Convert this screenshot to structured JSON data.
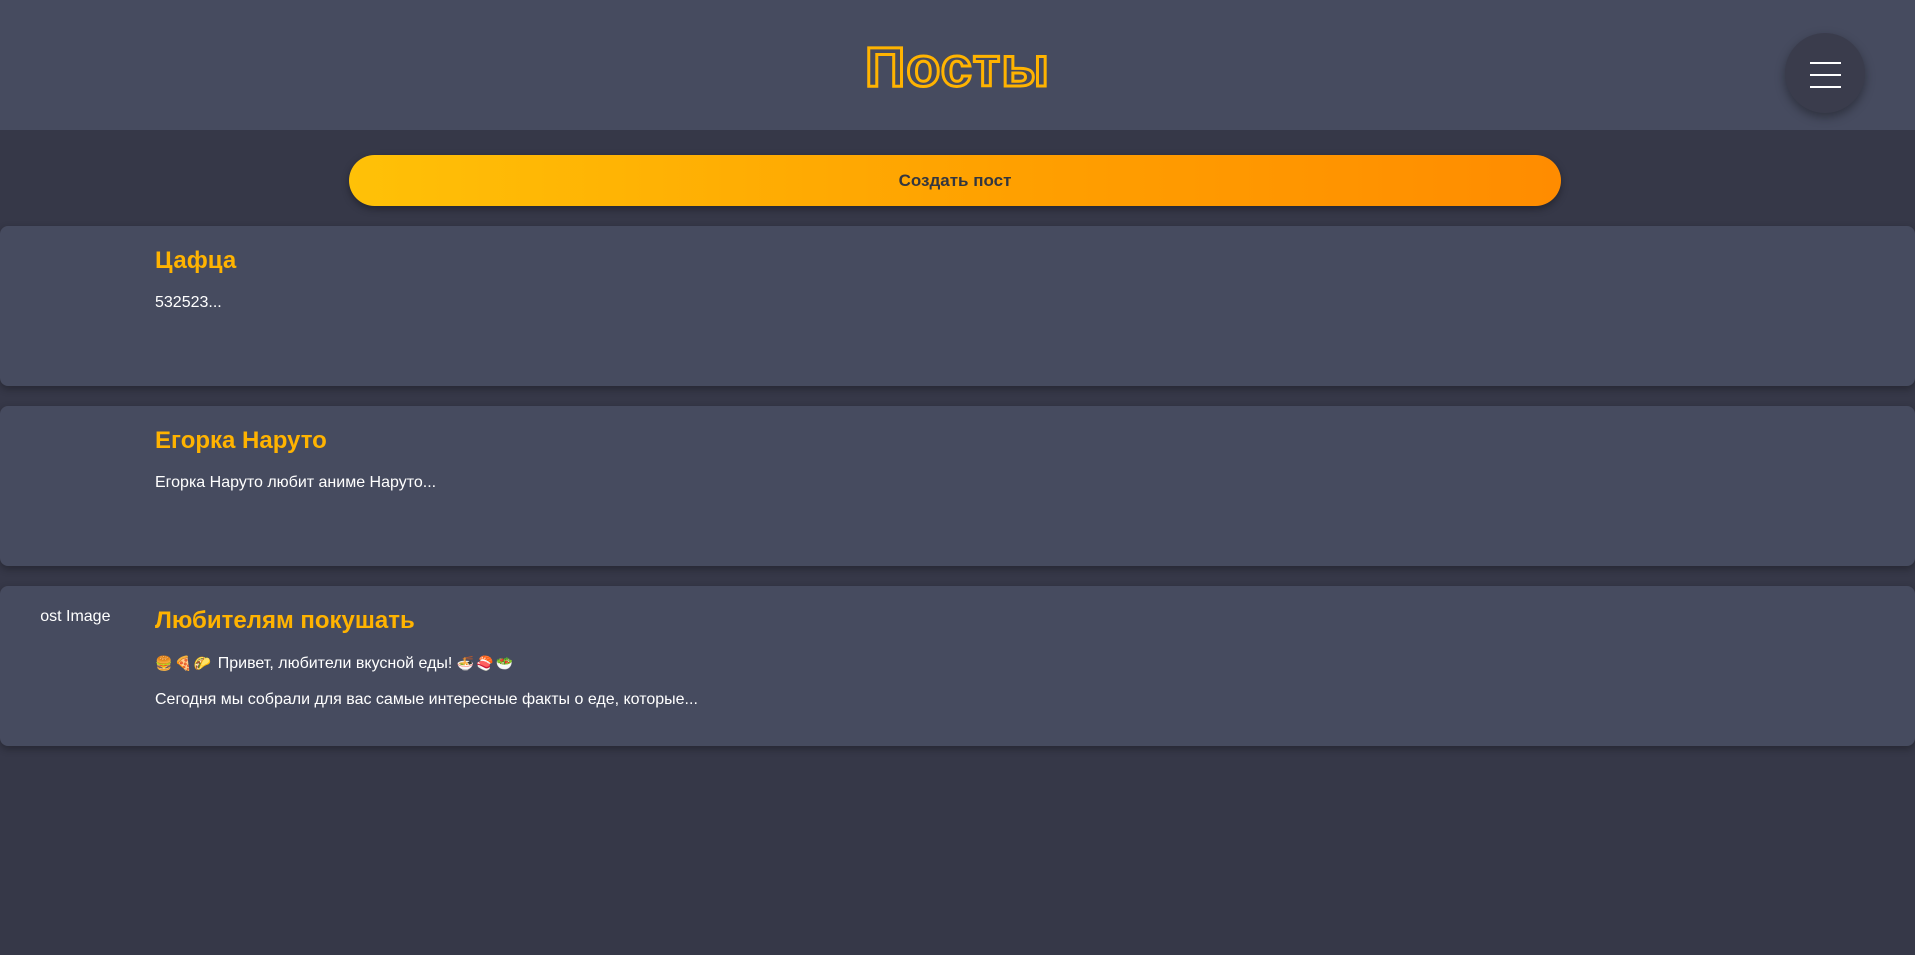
{
  "header": {
    "title": "Посты",
    "menu_icon": "hamburger-menu-icon"
  },
  "actions": {
    "create_post_label": "Создать пост"
  },
  "colors": {
    "accent": "#ffb300",
    "header_bg": "#464b5f",
    "page_bg": "#363848",
    "card_bg": "#464b5f",
    "button_gradient_start": "#ffc107",
    "button_gradient_end": "#ff8c00",
    "text": "#ffffff"
  },
  "posts": [
    {
      "title": "Цафца",
      "lines": [
        "532523..."
      ]
    },
    {
      "title": "Егорка Наруто",
      "lines": [
        "Егорка Наруто любит аниме Наруто..."
      ]
    },
    {
      "title": "Любителям покушать",
      "image_alt": "Post Image",
      "emoji_before": [
        "🍔",
        "🍕",
        "🌮"
      ],
      "line1_text": " Привет, любители вкусной еды! ",
      "emoji_after": [
        "🍜",
        "🍣",
        "🥗"
      ],
      "lines": [
        "Сегодня мы собрали для вас самые интересные факты о еде, которые..."
      ]
    }
  ]
}
